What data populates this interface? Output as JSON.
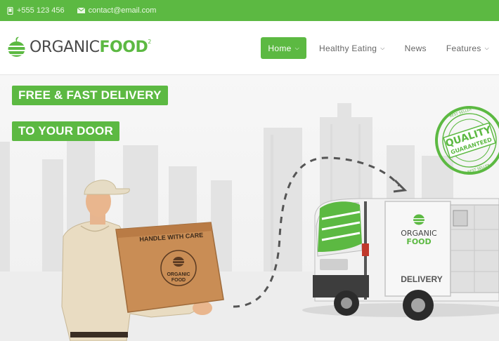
{
  "topbar": {
    "phone": "+555 123 456",
    "email": "contact@email.com",
    "phone_icon": "phone-icon",
    "email_icon": "envelope-icon",
    "bg_color": "#5cb942"
  },
  "logo": {
    "part1": "ORGANIC",
    "part2": "FOOD",
    "mark": "2"
  },
  "nav": {
    "items": [
      {
        "label": "Home",
        "active": true,
        "has_dropdown": true
      },
      {
        "label": "Healthy Eating",
        "active": false,
        "has_dropdown": true
      },
      {
        "label": "News",
        "active": false,
        "has_dropdown": false
      },
      {
        "label": "Features",
        "active": false,
        "has_dropdown": true
      }
    ]
  },
  "hero": {
    "headline1": "FREE & FAST DELIVERY",
    "headline2": "TO YOUR DOOR",
    "box_label": "HANDLE WITH CARE",
    "box_brand1": "ORGANIC",
    "box_brand2": "FOOD",
    "van_brand1": "ORGANIC",
    "van_brand2": "FOOD",
    "van_label": "DELIVERY",
    "stamp_line1": "QUALITY",
    "stamp_line2": "GUARANTEED",
    "stamp_ring": "BEST SELLER",
    "accent": "#5cb942"
  }
}
